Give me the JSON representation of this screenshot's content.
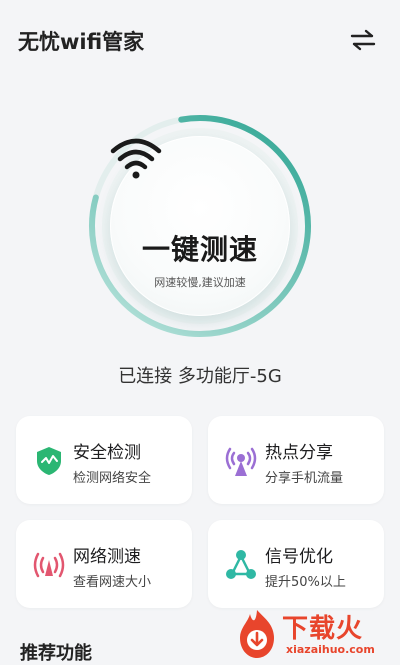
{
  "header": {
    "title": "无忧wifi管家",
    "swap_icon": "swap-arrows-icon"
  },
  "dial": {
    "title": "一键测速",
    "subtitle": "网速较慢,建议加速",
    "progress": 0.82,
    "accent": "#3fb8a8"
  },
  "connection": {
    "text": "已连接 多功能厅-5G"
  },
  "cards": [
    {
      "title": "安全检测",
      "subtitle": "检测网络安全",
      "icon": "shield-icon",
      "color": "#2bb673"
    },
    {
      "title": "热点分享",
      "subtitle": "分享手机流量",
      "icon": "hotspot-icon",
      "color": "#9b6fd4"
    },
    {
      "title": "网络测速",
      "subtitle": "查看网速大小",
      "icon": "signal-wave-icon",
      "color": "#e2566f"
    },
    {
      "title": "信号优化",
      "subtitle": "提升50%以上",
      "icon": "share-nodes-icon",
      "color": "#2fb8a4"
    }
  ],
  "section": {
    "title": "推荐功能"
  },
  "watermark": {
    "text": "下载火",
    "url": "xiazaihuo.com",
    "color": "#e8452c"
  }
}
